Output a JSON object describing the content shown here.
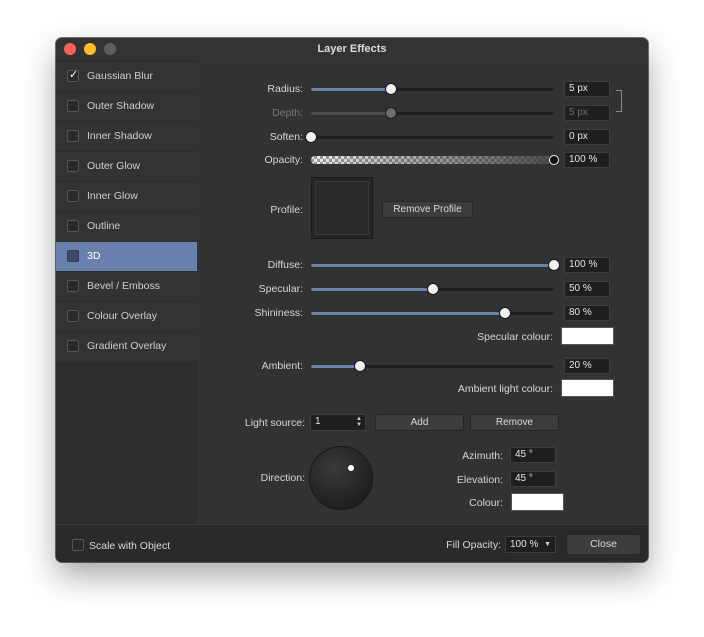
{
  "window": {
    "title": "Layer Effects"
  },
  "sidebar": {
    "items": [
      {
        "label": "Gaussian Blur",
        "checked": true,
        "selected": false
      },
      {
        "label": "Outer Shadow",
        "checked": false,
        "selected": false
      },
      {
        "label": "Inner Shadow",
        "checked": false,
        "selected": false
      },
      {
        "label": "Outer Glow",
        "checked": false,
        "selected": false
      },
      {
        "label": "Inner Glow",
        "checked": false,
        "selected": false
      },
      {
        "label": "Outline",
        "checked": false,
        "selected": false
      },
      {
        "label": "3D",
        "checked": false,
        "selected": true
      },
      {
        "label": "Bevel / Emboss",
        "checked": false,
        "selected": false
      },
      {
        "label": "Colour Overlay",
        "checked": false,
        "selected": false
      },
      {
        "label": "Gradient Overlay",
        "checked": false,
        "selected": false
      }
    ]
  },
  "controls": {
    "radius": {
      "label": "Radius:",
      "value": "5 px",
      "fraction": 0.33
    },
    "depth": {
      "label": "Depth:",
      "value": "5 px",
      "fraction": 0.33,
      "disabled": true
    },
    "soften": {
      "label": "Soften:",
      "value": "0 px",
      "fraction": 0.0
    },
    "opacity": {
      "label": "Opacity:",
      "value": "100 %",
      "fraction": 1.0
    },
    "profile": {
      "label": "Profile:",
      "remove_label": "Remove Profile"
    },
    "diffuse": {
      "label": "Diffuse:",
      "value": "100 %",
      "fraction": 1.0
    },
    "specular": {
      "label": "Specular:",
      "value": "50 %",
      "fraction": 0.5
    },
    "shininess": {
      "label": "Shininess:",
      "value": "80 %",
      "fraction": 0.8
    },
    "specular_colour": {
      "label": "Specular colour:",
      "color": "#ffffff"
    },
    "ambient": {
      "label": "Ambient:",
      "value": "20 %",
      "fraction": 0.2
    },
    "ambient_light_colour": {
      "label": "Ambient light colour:",
      "color": "#ffffff"
    },
    "light_source": {
      "label": "Light source:",
      "value": "1",
      "add_label": "Add",
      "remove_label": "Remove"
    },
    "direction": {
      "label": "Direction:",
      "azimuth_deg": 45,
      "elevation_deg": 45
    },
    "azimuth": {
      "label": "Azimuth:",
      "value": "45 °"
    },
    "elevation": {
      "label": "Elevation:",
      "value": "45 °"
    },
    "colour": {
      "label": "Colour:",
      "color": "#ffffff"
    }
  },
  "footer": {
    "scale_label": "Scale with Object",
    "fill_opacity_label": "Fill Opacity:",
    "fill_opacity_value": "100 %",
    "close_label": "Close"
  },
  "colors": {
    "accent": "#6a80ac",
    "close": "#fe5f57",
    "minimize": "#febc2e",
    "zoom": "#5e5e5e"
  }
}
